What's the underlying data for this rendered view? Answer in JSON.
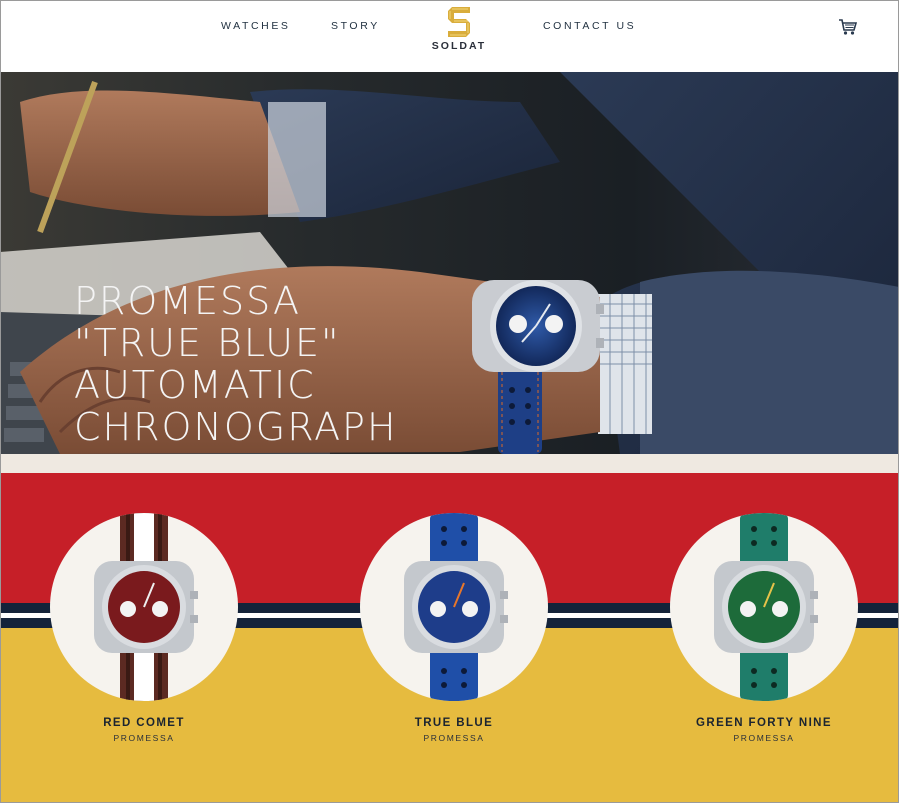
{
  "nav": {
    "watches": "WATCHES",
    "story": "STORY",
    "contact": "CONTACT US",
    "brand": "SOLDAT"
  },
  "hero": {
    "title_lines": [
      "PROMESSA",
      "\"TRUE BLUE\"",
      "AUTOMATIC",
      "CHRONOGRAPH"
    ]
  },
  "products": [
    {
      "name": "RED COMET",
      "collection": "PROMESSA",
      "dial_color": "#7a1a1d",
      "strap_color": "#5c2a22",
      "strap_stripe": "#ffffff"
    },
    {
      "name": "TRUE BLUE",
      "collection": "PROMESSA",
      "dial_color": "#1e3d8a",
      "strap_color": "#1f4fa8",
      "strap_stripe": ""
    },
    {
      "name": "GREEN FORTY NINE",
      "collection": "PROMESSA",
      "dial_color": "#1d6b3a",
      "strap_color": "#1f7d6a",
      "strap_stripe": ""
    }
  ],
  "colors": {
    "red": "#c61f28",
    "yellow": "#e6bb3f",
    "navy": "#14233a",
    "gold": "#d9ad3c"
  },
  "icons": {
    "cart": "cart-icon",
    "logo": "soldat-s-logo-icon"
  }
}
